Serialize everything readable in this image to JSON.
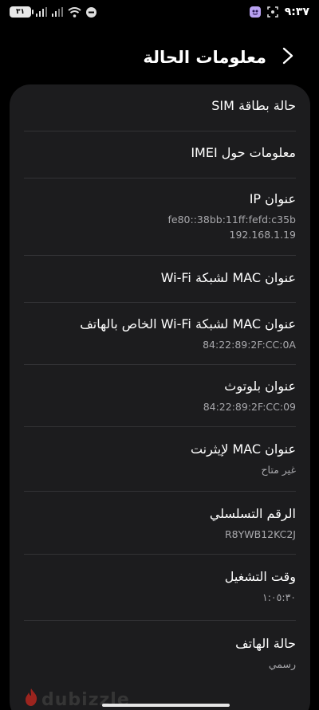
{
  "status_bar": {
    "time": "٩:٣٧",
    "battery": "٣١",
    "icons": [
      "battery-charging-icon",
      "signal-icon",
      "signal-icon-2",
      "wifi-icon",
      "do-not-disturb-icon",
      "screenshot-icon",
      "app-notification-icon"
    ]
  },
  "header": {
    "title": "معلومات الحالة",
    "back_icon": "chevron-back-icon"
  },
  "rows": [
    {
      "title": "حالة بطاقة SIM",
      "value": ""
    },
    {
      "title": "معلومات حول IMEI",
      "value": ""
    },
    {
      "title": "عنوان IP",
      "value": "fe80::38bb:11ff:fefd:c35b",
      "value2": "192.168.1.19"
    },
    {
      "title": "عنوان MAC لشبكة Wi-Fi",
      "value": ""
    },
    {
      "title": "عنوان MAC لشبكة Wi-Fi الخاص بالهاتف",
      "value": "84:22:89:2F:CC:0A"
    },
    {
      "title": "عنوان بلوتوث",
      "value": "84:22:89:2F:CC:09"
    },
    {
      "title": "عنوان MAC لإيثرنت",
      "value": "غير متاح"
    },
    {
      "title": "الرقم التسلسلي",
      "value": "R8YWB12KC2J"
    },
    {
      "title": "وقت التشغيل",
      "value": "١:٠٥:٣٠"
    },
    {
      "title": "حالة الهاتف",
      "value": "رسمي"
    }
  ],
  "watermark": {
    "text": "dubizzle"
  }
}
